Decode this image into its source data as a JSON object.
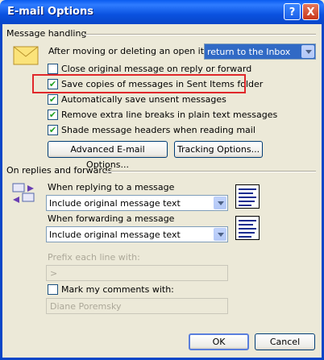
{
  "window": {
    "title": "E-mail Options",
    "help_glyph": "?",
    "close_glyph": "X"
  },
  "message_handling": {
    "heading": "Message handling",
    "after_moving_label": "After moving or deleting an open item:",
    "after_moving_value": "return to the Inbox",
    "options": [
      {
        "label": "Close original message on reply or forward",
        "checked": false
      },
      {
        "label": "Save copies of messages in Sent Items folder",
        "checked": true
      },
      {
        "label": "Automatically save unsent messages",
        "checked": true
      },
      {
        "label": "Remove extra line breaks in plain text messages",
        "checked": true
      },
      {
        "label": "Shade message headers when reading mail",
        "checked": true
      }
    ],
    "advanced_button": "Advanced E-mail Options...",
    "tracking_button": "Tracking Options..."
  },
  "replies": {
    "heading": "On replies and forwards",
    "reply_label": "When replying to a message",
    "reply_value": "Include original message text",
    "forward_label": "When forwarding a message",
    "forward_value": "Include original message text",
    "prefix_label": "Prefix each line with:",
    "prefix_value": ">",
    "mark_label": "Mark my comments with:",
    "mark_checked": false,
    "mark_value": "Diane Poremsky"
  },
  "footer": {
    "ok": "OK",
    "cancel": "Cancel"
  }
}
